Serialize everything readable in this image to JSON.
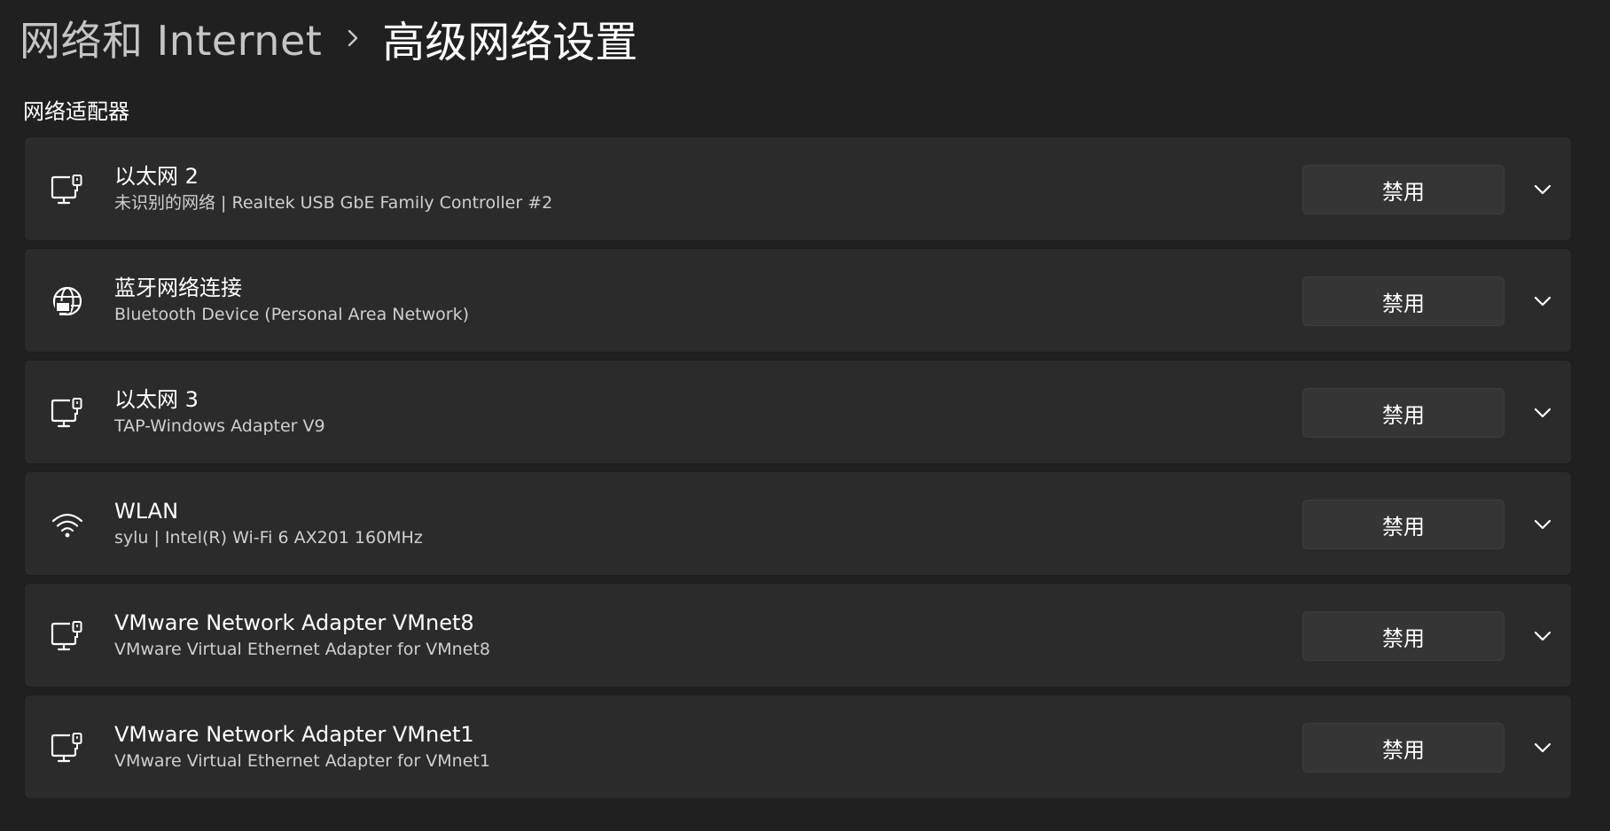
{
  "breadcrumb": {
    "parent": "网络和 Internet",
    "current": "高级网络设置"
  },
  "section": {
    "title": "网络适配器"
  },
  "adapters": [
    {
      "name": "以太网 2",
      "description": "未识别的网络 | Realtek USB GbE Family Controller #2",
      "icon": "ethernet-monitor-icon",
      "button_label": "禁用"
    },
    {
      "name": "蓝牙网络连接",
      "description": "Bluetooth Device (Personal Area Network)",
      "icon": "globe-network-icon",
      "button_label": "禁用"
    },
    {
      "name": "以太网 3",
      "description": "TAP-Windows Adapter V9",
      "icon": "ethernet-monitor-icon",
      "button_label": "禁用"
    },
    {
      "name": "WLAN",
      "description": "sylu | Intel(R) Wi-Fi 6 AX201 160MHz",
      "icon": "wifi-icon",
      "button_label": "禁用"
    },
    {
      "name": "VMware Network Adapter VMnet8",
      "description": "VMware Virtual Ethernet Adapter for VMnet8",
      "icon": "ethernet-monitor-icon",
      "button_label": "禁用"
    },
    {
      "name": "VMware Network Adapter VMnet1",
      "description": "VMware Virtual Ethernet Adapter for VMnet1",
      "icon": "ethernet-monitor-icon",
      "button_label": "禁用"
    }
  ],
  "colors": {
    "background": "#202020",
    "card": "#2b2b2b",
    "button": "#353535",
    "text_primary": "#ffffff",
    "text_secondary": "#cfcfcf"
  }
}
